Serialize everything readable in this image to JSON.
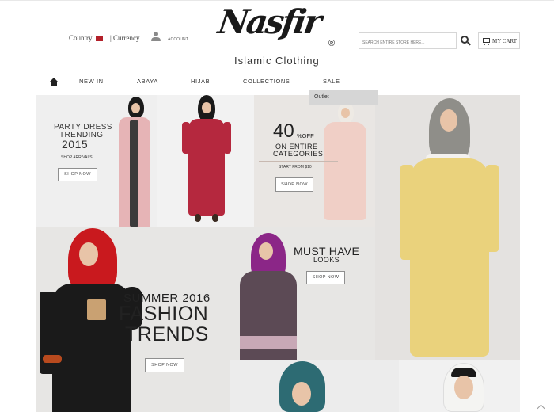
{
  "header": {
    "country_label": "Country",
    "currency_label": "| Currency",
    "account_label": "ACCOUNT",
    "brand": "Nasfir",
    "brand_mark": "®",
    "tagline": "Islamic Clothing",
    "search_placeholder": "SEARCH ENTIRE STORE HERE...",
    "cart_label": "MY CART",
    "icons": [
      "flag-icon",
      "user-icon",
      "search-icon",
      "cart-icon"
    ]
  },
  "nav": {
    "items": [
      "NEW IN",
      "ABAYA",
      "HIJAB",
      "COLLECTIONS",
      "SALE"
    ],
    "dropdown": [
      "Outlet"
    ]
  },
  "banners": {
    "party": {
      "line1": "PARTY DRESS",
      "line2": "TRENDING",
      "line3": "2015",
      "sub": "SHOP ARRIVALS!",
      "button": "SHOP NOW"
    },
    "offer": {
      "number": "40",
      "suffix": "%OFF",
      "line1": "ON ENTIRE",
      "line2": "CATEGORIES",
      "sub": "START FROM $10",
      "button": "SHOP NOW"
    },
    "summer": {
      "line1": "SUMMER 2016",
      "line2": "FASHION",
      "line3": "TRENDS",
      "button": "SHOP NOW"
    },
    "must": {
      "line1": "MUST HAVE",
      "line2": "LOOKS",
      "button": "SHOP NOW"
    }
  },
  "colors": {
    "accent": "#b3202a",
    "dropdown_bg": "#d6d6d6"
  }
}
